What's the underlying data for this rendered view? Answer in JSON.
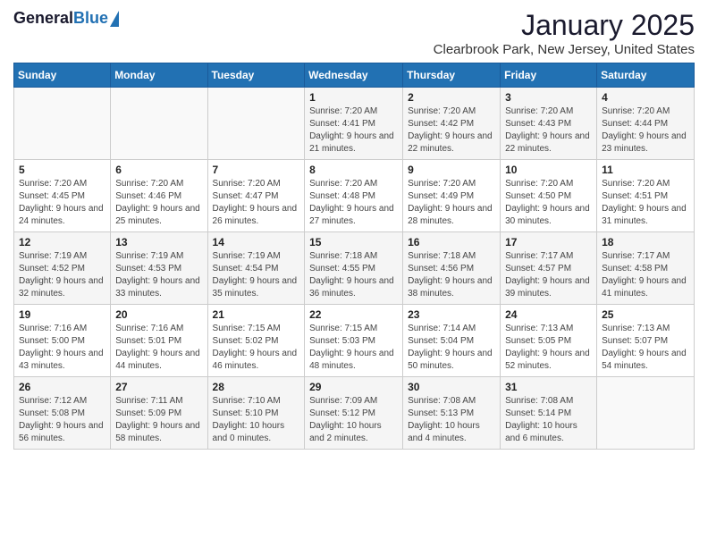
{
  "header": {
    "logo_general": "General",
    "logo_blue": "Blue",
    "month": "January 2025",
    "location": "Clearbrook Park, New Jersey, United States"
  },
  "weekdays": [
    "Sunday",
    "Monday",
    "Tuesday",
    "Wednesday",
    "Thursday",
    "Friday",
    "Saturday"
  ],
  "weeks": [
    [
      {
        "day": "",
        "sunrise": "",
        "sunset": "",
        "daylight": ""
      },
      {
        "day": "",
        "sunrise": "",
        "sunset": "",
        "daylight": ""
      },
      {
        "day": "",
        "sunrise": "",
        "sunset": "",
        "daylight": ""
      },
      {
        "day": "1",
        "sunrise": "Sunrise: 7:20 AM",
        "sunset": "Sunset: 4:41 PM",
        "daylight": "Daylight: 9 hours and 21 minutes."
      },
      {
        "day": "2",
        "sunrise": "Sunrise: 7:20 AM",
        "sunset": "Sunset: 4:42 PM",
        "daylight": "Daylight: 9 hours and 22 minutes."
      },
      {
        "day": "3",
        "sunrise": "Sunrise: 7:20 AM",
        "sunset": "Sunset: 4:43 PM",
        "daylight": "Daylight: 9 hours and 22 minutes."
      },
      {
        "day": "4",
        "sunrise": "Sunrise: 7:20 AM",
        "sunset": "Sunset: 4:44 PM",
        "daylight": "Daylight: 9 hours and 23 minutes."
      }
    ],
    [
      {
        "day": "5",
        "sunrise": "Sunrise: 7:20 AM",
        "sunset": "Sunset: 4:45 PM",
        "daylight": "Daylight: 9 hours and 24 minutes."
      },
      {
        "day": "6",
        "sunrise": "Sunrise: 7:20 AM",
        "sunset": "Sunset: 4:46 PM",
        "daylight": "Daylight: 9 hours and 25 minutes."
      },
      {
        "day": "7",
        "sunrise": "Sunrise: 7:20 AM",
        "sunset": "Sunset: 4:47 PM",
        "daylight": "Daylight: 9 hours and 26 minutes."
      },
      {
        "day": "8",
        "sunrise": "Sunrise: 7:20 AM",
        "sunset": "Sunset: 4:48 PM",
        "daylight": "Daylight: 9 hours and 27 minutes."
      },
      {
        "day": "9",
        "sunrise": "Sunrise: 7:20 AM",
        "sunset": "Sunset: 4:49 PM",
        "daylight": "Daylight: 9 hours and 28 minutes."
      },
      {
        "day": "10",
        "sunrise": "Sunrise: 7:20 AM",
        "sunset": "Sunset: 4:50 PM",
        "daylight": "Daylight: 9 hours and 30 minutes."
      },
      {
        "day": "11",
        "sunrise": "Sunrise: 7:20 AM",
        "sunset": "Sunset: 4:51 PM",
        "daylight": "Daylight: 9 hours and 31 minutes."
      }
    ],
    [
      {
        "day": "12",
        "sunrise": "Sunrise: 7:19 AM",
        "sunset": "Sunset: 4:52 PM",
        "daylight": "Daylight: 9 hours and 32 minutes."
      },
      {
        "day": "13",
        "sunrise": "Sunrise: 7:19 AM",
        "sunset": "Sunset: 4:53 PM",
        "daylight": "Daylight: 9 hours and 33 minutes."
      },
      {
        "day": "14",
        "sunrise": "Sunrise: 7:19 AM",
        "sunset": "Sunset: 4:54 PM",
        "daylight": "Daylight: 9 hours and 35 minutes."
      },
      {
        "day": "15",
        "sunrise": "Sunrise: 7:18 AM",
        "sunset": "Sunset: 4:55 PM",
        "daylight": "Daylight: 9 hours and 36 minutes."
      },
      {
        "day": "16",
        "sunrise": "Sunrise: 7:18 AM",
        "sunset": "Sunset: 4:56 PM",
        "daylight": "Daylight: 9 hours and 38 minutes."
      },
      {
        "day": "17",
        "sunrise": "Sunrise: 7:17 AM",
        "sunset": "Sunset: 4:57 PM",
        "daylight": "Daylight: 9 hours and 39 minutes."
      },
      {
        "day": "18",
        "sunrise": "Sunrise: 7:17 AM",
        "sunset": "Sunset: 4:58 PM",
        "daylight": "Daylight: 9 hours and 41 minutes."
      }
    ],
    [
      {
        "day": "19",
        "sunrise": "Sunrise: 7:16 AM",
        "sunset": "Sunset: 5:00 PM",
        "daylight": "Daylight: 9 hours and 43 minutes."
      },
      {
        "day": "20",
        "sunrise": "Sunrise: 7:16 AM",
        "sunset": "Sunset: 5:01 PM",
        "daylight": "Daylight: 9 hours and 44 minutes."
      },
      {
        "day": "21",
        "sunrise": "Sunrise: 7:15 AM",
        "sunset": "Sunset: 5:02 PM",
        "daylight": "Daylight: 9 hours and 46 minutes."
      },
      {
        "day": "22",
        "sunrise": "Sunrise: 7:15 AM",
        "sunset": "Sunset: 5:03 PM",
        "daylight": "Daylight: 9 hours and 48 minutes."
      },
      {
        "day": "23",
        "sunrise": "Sunrise: 7:14 AM",
        "sunset": "Sunset: 5:04 PM",
        "daylight": "Daylight: 9 hours and 50 minutes."
      },
      {
        "day": "24",
        "sunrise": "Sunrise: 7:13 AM",
        "sunset": "Sunset: 5:05 PM",
        "daylight": "Daylight: 9 hours and 52 minutes."
      },
      {
        "day": "25",
        "sunrise": "Sunrise: 7:13 AM",
        "sunset": "Sunset: 5:07 PM",
        "daylight": "Daylight: 9 hours and 54 minutes."
      }
    ],
    [
      {
        "day": "26",
        "sunrise": "Sunrise: 7:12 AM",
        "sunset": "Sunset: 5:08 PM",
        "daylight": "Daylight: 9 hours and 56 minutes."
      },
      {
        "day": "27",
        "sunrise": "Sunrise: 7:11 AM",
        "sunset": "Sunset: 5:09 PM",
        "daylight": "Daylight: 9 hours and 58 minutes."
      },
      {
        "day": "28",
        "sunrise": "Sunrise: 7:10 AM",
        "sunset": "Sunset: 5:10 PM",
        "daylight": "Daylight: 10 hours and 0 minutes."
      },
      {
        "day": "29",
        "sunrise": "Sunrise: 7:09 AM",
        "sunset": "Sunset: 5:12 PM",
        "daylight": "Daylight: 10 hours and 2 minutes."
      },
      {
        "day": "30",
        "sunrise": "Sunrise: 7:08 AM",
        "sunset": "Sunset: 5:13 PM",
        "daylight": "Daylight: 10 hours and 4 minutes."
      },
      {
        "day": "31",
        "sunrise": "Sunrise: 7:08 AM",
        "sunset": "Sunset: 5:14 PM",
        "daylight": "Daylight: 10 hours and 6 minutes."
      },
      {
        "day": "",
        "sunrise": "",
        "sunset": "",
        "daylight": ""
      }
    ]
  ]
}
